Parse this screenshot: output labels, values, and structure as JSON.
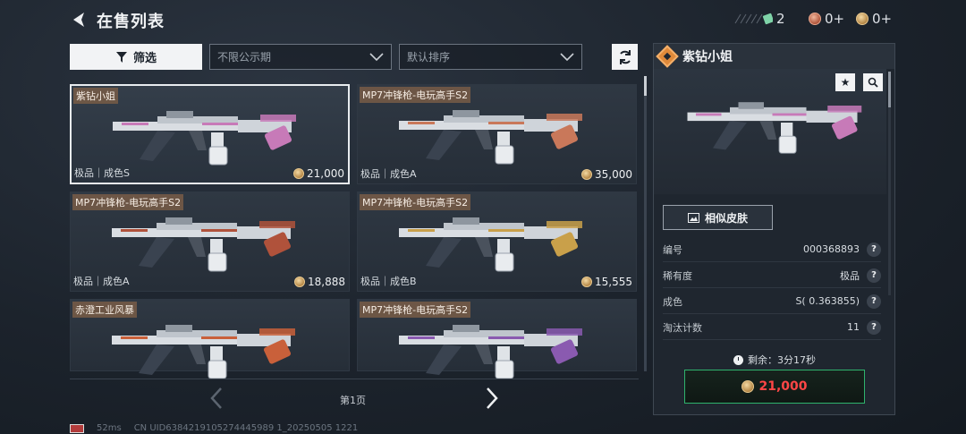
{
  "header": {
    "title": "在售列表",
    "currencies": [
      {
        "icon": "ticket-icon",
        "value": "2"
      },
      {
        "icon": "red-coin-icon",
        "value": "0+"
      },
      {
        "icon": "gold-coin-icon",
        "value": "0+"
      }
    ]
  },
  "toolbar": {
    "filter_label": "筛选",
    "period_select": "不限公示期",
    "sort_select": "默认排序"
  },
  "listings": [
    {
      "name": "紫钻小姐",
      "grade": "极品｜成色S",
      "price": "21,000",
      "selected": true,
      "accent": "#c77ab8"
    },
    {
      "name": "MP7冲锋枪-电玩高手S2",
      "grade": "极品｜成色A",
      "price": "35,000",
      "selected": false,
      "accent": "#c9785a"
    },
    {
      "name": "MP7冲锋枪-电玩高手S2",
      "grade": "极品｜成色A",
      "price": "18,888",
      "selected": false,
      "accent": "#b0523b"
    },
    {
      "name": "MP7冲锋枪-电玩高手S2",
      "grade": "极品｜成色B",
      "price": "15,555",
      "selected": false,
      "accent": "#c9a04a"
    },
    {
      "name": "赤澄工业风暴",
      "grade": "",
      "price": "",
      "selected": false,
      "accent": "#c9603a"
    },
    {
      "name": "MP7冲锋枪-电玩高手S2",
      "grade": "",
      "price": "",
      "selected": false,
      "accent": "#8a5ab0"
    }
  ],
  "pager": {
    "label": "第1页"
  },
  "footer": {
    "ping": "52ms",
    "uid": "CN UID6384219105274445989 1_20250505 1221"
  },
  "detail": {
    "title": "紫钻小姐",
    "similar_label": "相似皮肤",
    "fields": [
      {
        "label": "编号",
        "value": "000368893"
      },
      {
        "label": "稀有度",
        "value": "极品"
      },
      {
        "label": "成色",
        "value": "S( 0.363855)"
      },
      {
        "label": "淘汰计数",
        "value": "11"
      }
    ],
    "timer": "剩余：3分17秒",
    "buy_price": "21,000"
  }
}
